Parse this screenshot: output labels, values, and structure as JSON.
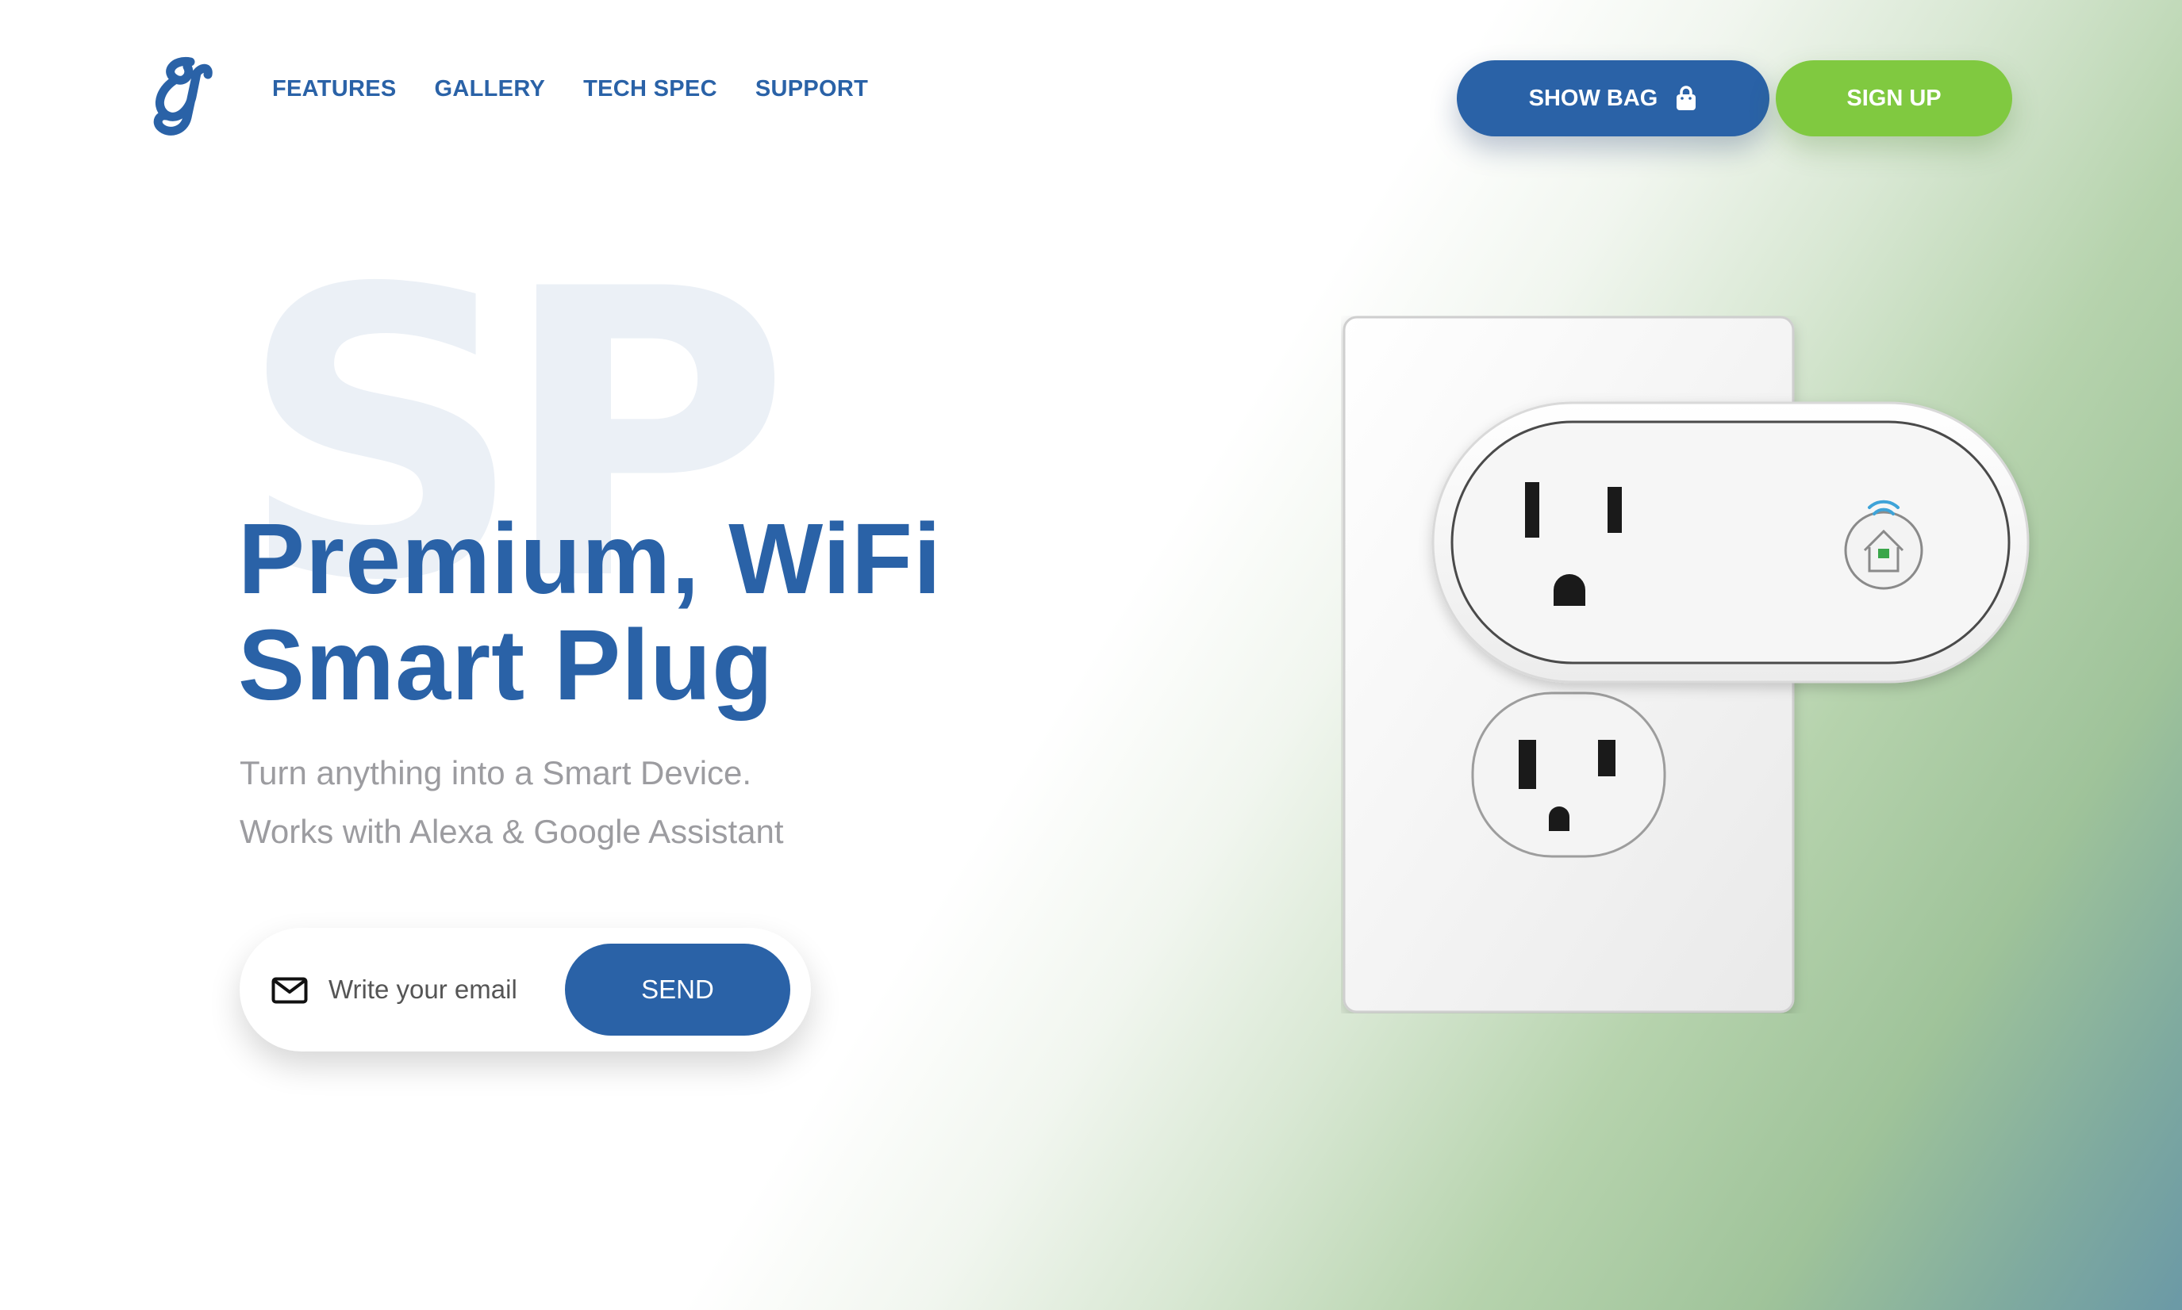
{
  "brand": {
    "logo_icon": "script-g-logo-icon"
  },
  "nav": {
    "items": [
      {
        "label": "FEATURES"
      },
      {
        "label": "GALLERY"
      },
      {
        "label": "TECH SPEC"
      },
      {
        "label": "SUPPORT"
      }
    ]
  },
  "header": {
    "show_bag_label": "SHOW BAG",
    "bag_icon": "shopping-bag-icon",
    "signup_label": "SIGN UP"
  },
  "hero": {
    "background_text": "SP",
    "title_line1": "Premium, WiFi",
    "title_line2": "Smart Plug",
    "subtitle_line1": "Turn anything into a Smart Device.",
    "subtitle_line2": "Works with Alexa & Google Assistant"
  },
  "signup_form": {
    "email_value": "",
    "email_placeholder": "Write your email",
    "mail_icon": "envelope-icon",
    "send_label": "SEND"
  },
  "colors": {
    "primary": "#2a62a7",
    "accent": "#80c940",
    "muted_text": "#9c9ca0",
    "bg_letters": "#ebf0f6"
  }
}
